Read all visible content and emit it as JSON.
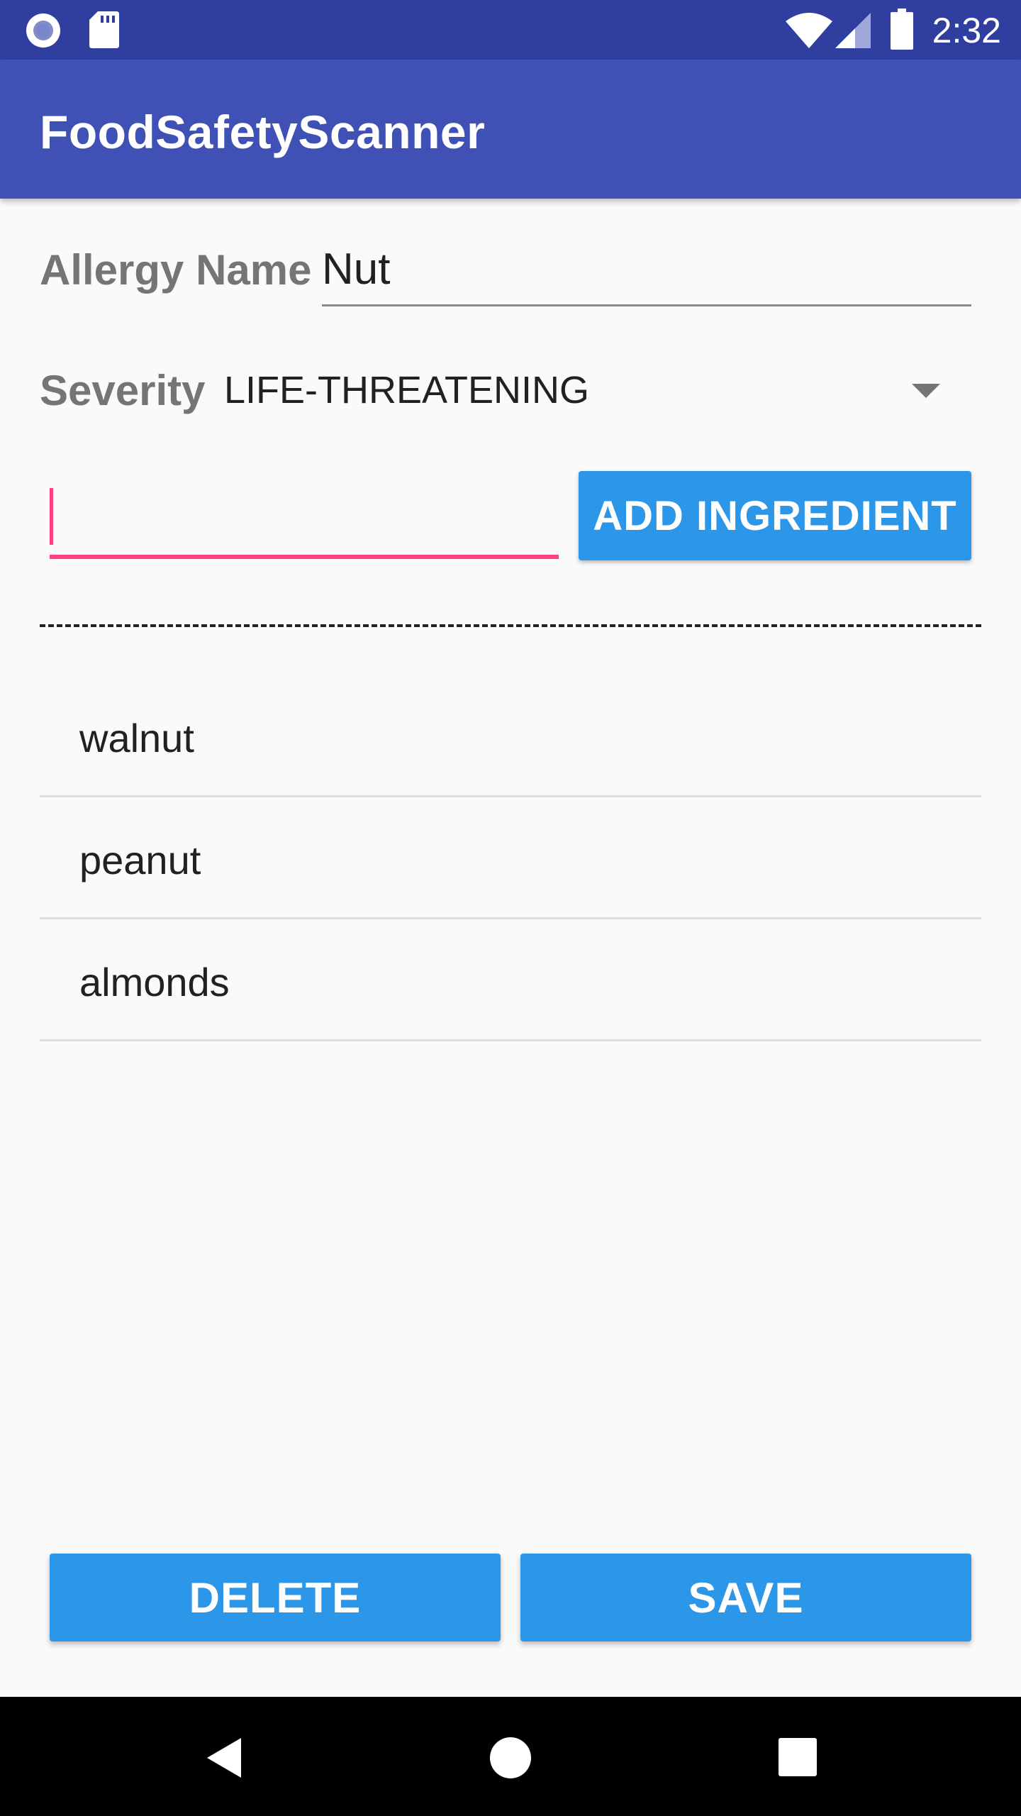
{
  "status_bar": {
    "time": "2:32",
    "icons": [
      "record-icon",
      "sd-card-icon",
      "wifi-icon",
      "signal-icon",
      "battery-icon"
    ],
    "background": "#303f9f"
  },
  "app_bar": {
    "title": "FoodSafetyScanner",
    "background": "#3f51b5"
  },
  "form": {
    "allergy_name_label": "Allergy Name",
    "allergy_name_value": "Nut",
    "severity_label": "Severity",
    "severity_value": "LIFE-THREATENING",
    "ingredient_input_value": "",
    "add_ingredient_label": "ADD INGREDIENT"
  },
  "ingredients": [
    "walnut",
    "peanut",
    "almonds"
  ],
  "actions": {
    "delete_label": "DELETE",
    "save_label": "SAVE"
  },
  "nav_bar": {
    "icons": [
      "back-icon",
      "home-icon",
      "recents-icon"
    ]
  },
  "colors": {
    "accent": "#ff4081",
    "button": "#2c96e8",
    "primary": "#3f51b5",
    "primary_dark": "#303f9f"
  }
}
